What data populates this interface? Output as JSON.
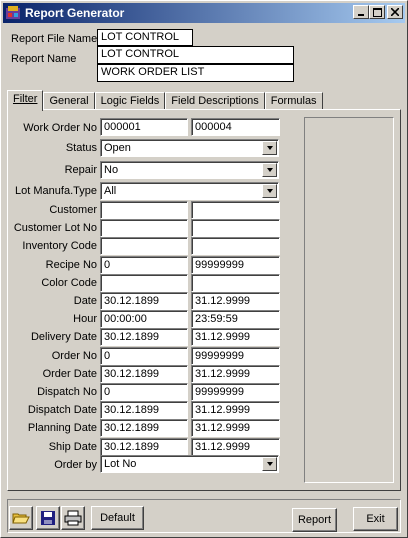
{
  "window": {
    "title": "Report Generator",
    "icon": "report-app-icon"
  },
  "header": {
    "file_name_label": "Report File Name",
    "file_name_value": "LOT CONTROL",
    "report_name_label": "Report Name",
    "report_name_value": "LOT CONTROL",
    "report_subname_value": "WORK ORDER LIST"
  },
  "tabs": [
    "Filter",
    "General",
    "Logic Fields",
    "Field Descriptions",
    "Formulas"
  ],
  "filter": {
    "work_order_no": {
      "label": "Work Order No",
      "from": "000001",
      "to": "000004"
    },
    "status": {
      "label": "Status",
      "value": "Open"
    },
    "repair": {
      "label": "Repair",
      "value": "No"
    },
    "lot_type": {
      "label": "Lot Manufa.Type",
      "value": "All"
    },
    "rows": [
      {
        "label": "Customer",
        "from": "",
        "to": ""
      },
      {
        "label": "Customer Lot No",
        "from": "",
        "to": ""
      },
      {
        "label": "Inventory Code",
        "from": "",
        "to": ""
      },
      {
        "label": "Recipe No",
        "from": "0",
        "to": "99999999"
      },
      {
        "label": "Color Code",
        "from": "",
        "to": ""
      },
      {
        "label": "Date",
        "from": "30.12.1899",
        "to": "31.12.9999"
      },
      {
        "label": "Hour",
        "from": "00:00:00",
        "to": "23:59:59"
      },
      {
        "label": "Delivery Date",
        "from": "30.12.1899",
        "to": "31.12.9999"
      },
      {
        "label": "Order No",
        "from": "0",
        "to": "99999999"
      },
      {
        "label": "Order Date",
        "from": "30.12.1899",
        "to": "31.12.9999"
      },
      {
        "label": "Dispatch No",
        "from": "0",
        "to": "99999999"
      },
      {
        "label": "Dispatch Date",
        "from": "30.12.1899",
        "to": "31.12.9999"
      },
      {
        "label": "Planning Date",
        "from": "30.12.1899",
        "to": "31.12.9999"
      },
      {
        "label": "Ship Date",
        "from": "30.12.1899",
        "to": "31.12.9999"
      }
    ],
    "order_by": {
      "label": "Order by",
      "value": "Lot No"
    }
  },
  "buttons": {
    "default": "Default",
    "report": "Report",
    "exit": "Exit"
  },
  "colors": {
    "titlebar_start": "#0a246a",
    "titlebar_end": "#a6caf0",
    "face": "#d4d0c8"
  }
}
